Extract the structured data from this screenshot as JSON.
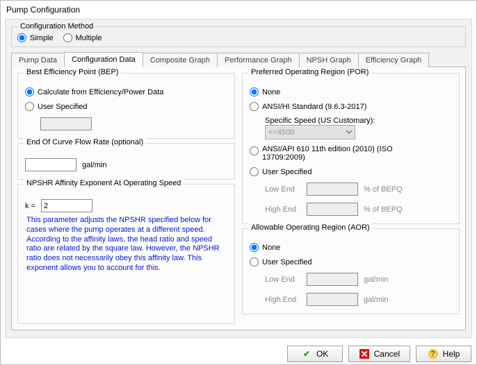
{
  "window": {
    "title": "Pump Configuration"
  },
  "config_method": {
    "legend": "Configuration Method",
    "simple": "Simple",
    "multiple": "Multiple"
  },
  "tabs": [
    {
      "label": "Pump Data"
    },
    {
      "label": "Configuration Data"
    },
    {
      "label": "Composite Graph"
    },
    {
      "label": "Performance Graph"
    },
    {
      "label": "NPSH Graph"
    },
    {
      "label": "Efficiency Graph"
    }
  ],
  "bep": {
    "title": "Best Efficiency Point (BEP)",
    "opt_calc": "Calculate from Efficiency/Power Data",
    "opt_user": "User Specified",
    "user_value": ""
  },
  "eoc": {
    "title": "End Of Curve Flow Rate (optional)",
    "value": "",
    "unit": "gal/min"
  },
  "npshr": {
    "title": "NPSHR Affinity Exponent At Operating Speed",
    "k_label": "k =",
    "k_value": "2",
    "note": "This parameter adjusts the NPSHR specified below for cases where the pump operates at a different speed. According to the affinity laws, the head ratio and speed ratio are related by the square law. However, the NPSHR ratio does not necessarily obey this affinity law. This exponent allows you to account for this."
  },
  "por": {
    "title": "Preferred Operating Region (POR)",
    "opt_none": "None",
    "opt_ansi_hi": "ANSI/HI Standard (9.6.3-2017)",
    "specific_speed_label": "Specific Speed (US Customary):",
    "specific_speed_value": "<=4500",
    "opt_ansi_api": "ANSI/API 610 11th edition (2010) (ISO 13709:2009)",
    "opt_user": "User Specified",
    "low_end_label": "Low End",
    "low_end_value": "",
    "high_end_label": "High End",
    "high_end_value": "",
    "pct_unit": "% of BEPQ"
  },
  "aor": {
    "title": "Allowable Operating Region (AOR)",
    "opt_none": "None",
    "opt_user": "User Specified",
    "low_end_label": "Low End",
    "low_end_value": "",
    "high_end_label": "High End",
    "high_end_value": "",
    "unit": "gal/min"
  },
  "buttons": {
    "ok": "OK",
    "cancel": "Cancel",
    "help": "Help"
  }
}
